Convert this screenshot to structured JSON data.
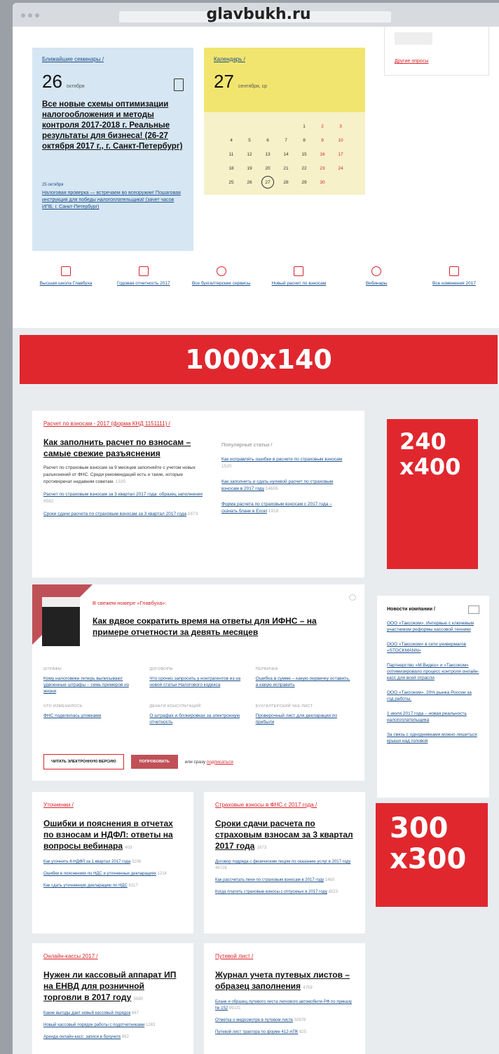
{
  "browser": {
    "domain": "glavbukh.ru"
  },
  "seminars": {
    "label": "Ближайшие семинары /",
    "day": "26",
    "month": "октября",
    "title": "Все новые схемы оптимизации налогообложения и методы контроля 2017-2018 г. Реальные результаты для бизнеса! (26-27 октября 2017 г., г. Санкт-Петербург)",
    "sub_date": "25 октября",
    "sub_text": "Налоговая проверка — встречаем во всеоружии! Пошаговая инструкция для победы налогоплательщика! (зачет часов ИПБ, г. Санкт-Петербург)"
  },
  "calendar": {
    "label": "Календарь /",
    "day": "27",
    "month": "сентября, ср",
    "rows": [
      [
        "",
        "",
        "",
        "",
        "1",
        "2",
        "3"
      ],
      [
        "4",
        "5",
        "6",
        "7",
        "8",
        "9",
        "10"
      ],
      [
        "11",
        "12",
        "13",
        "14",
        "15",
        "16",
        "17"
      ],
      [
        "18",
        "19",
        "20",
        "21",
        "22",
        "23",
        "24"
      ],
      [
        "25",
        "26",
        "27",
        "28",
        "29",
        "30",
        ""
      ]
    ]
  },
  "poll": {
    "other_link": "Другие опросы"
  },
  "quick_links": [
    {
      "label": "Высшая школа Главбуха",
      "icon": "book-icon"
    },
    {
      "label": "Годовая отчетность 2017",
      "icon": "document-icon"
    },
    {
      "label": "Все бухгалтерские сервисы",
      "icon": "chat-icon"
    },
    {
      "label": "Новый расчет по взносам",
      "icon": "calculator-icon"
    },
    {
      "label": "Вебинары",
      "icon": "play-icon"
    },
    {
      "label": "Все изменения 2017",
      "icon": "calendar-icon"
    }
  ],
  "banner_top": "1000x140",
  "card1": {
    "label": "Расчет по взносам - 2017 (форма КНД 1151111) /",
    "headline": "Как заполнить расчет по взносам – самые свежие разъяснения",
    "lead": "Расчет по страховым взносам за 9 месяцев заполняйте с учетом новых разъяснений от ФНС. Среди рекомендаций есть и такие, которые противоречат недавним советам.",
    "lead_views": "1335",
    "links": [
      {
        "text": "Расчет по страховым взносам за 3 квартал 2017 года: образец заполнения",
        "views": "9582"
      },
      {
        "text": "Сроки сдачи расчета по страховым взносам за 3 квартал 2017 года",
        "views": "1673"
      }
    ],
    "popular_title": "Популярные статьи /",
    "popular": [
      {
        "text": "Как исправлять ошибки в расчете по страховым взносам",
        "views": "1520"
      },
      {
        "text": "Как заполнить и сдать нулевой расчет по страховым взносам в 2017 году",
        "views": "14606"
      },
      {
        "text": "Форма расчета по страховым взносам с 2017 года – скачать бланк в Excel",
        "views": "1918"
      }
    ]
  },
  "ad_240": "240 x400",
  "card2": {
    "label": "В свежем номере «Главбуха»:",
    "headline": "Как вдвое сократить время на ответы для ИФНС – на примере отчетности за девять месяцев",
    "items": [
      {
        "head": "ШТРАФЫ",
        "text": "Кому налоговики теперь выписывают удвоенные штрафы – семь примеров из жизни"
      },
      {
        "head": "ДОГОВОРЫ",
        "text": "Что срочно запросить у контрагентов из-за новой статьи Налогового кодекса"
      },
      {
        "head": "ПЕРВИЧКА",
        "text": "Ошибка в сумме – какую первичку оставить, а какую исправить"
      },
      {
        "head": "ЧТО ИЗМЕНИЛОСЬ",
        "text": "ФНС поделилась уловками"
      },
      {
        "head": "ДЕНЬГИ КОНСУЛЬТАЦИЙ",
        "text": "О штрафах и блокировках за электронную отчетность"
      },
      {
        "head": "БУХГАЛТЕРСКИЙ ЧЕК-ЛИСТ",
        "text": "Проверочный лист для декларации по прибыли"
      }
    ],
    "btn_read": "ЧИТАТЬ ЭЛЕКТРОННУЮ ВЕРСИЮ",
    "btn_try": "ПОПРОБОВАТЬ",
    "or_text": "или сразу",
    "subscribe": "подписаться"
  },
  "news": {
    "title": "Новости компании /",
    "items": [
      "ООО «Таксоком». Интервью с ключевым участником реформы кассовой техники",
      "ООО «Таксоком» в сети универмагов «STOCKMANN»",
      "Партнерство «М.Видео» и «Таксоком» оптимизировало процесс контроля онлайн-касс для всей отрасли",
      "ООО «Таксоком». 20% рынка России за год работы.",
      "1 июля 2017 года – новая реальность налогоплательщика",
      "За связь с однодневками можно лишиться крыши над головой"
    ]
  },
  "ad_300": "300 x300",
  "card3": {
    "label": "Уточненки /",
    "headline": "Ошибки и пояснения в отчетах по взносам и НДФЛ: ответы на вопросы вебинара",
    "headline_views": "403",
    "links": [
      {
        "text": "Как уточнить 6-НДФЛ за 1 квартал 2017 года",
        "views": "3106"
      },
      {
        "text": "Ошибки в пояснениях по НДС и уточненных декларациях",
        "views": "1214"
      },
      {
        "text": "Как сдать уточненную декларацию по НДС",
        "views": "6317"
      }
    ]
  },
  "card4": {
    "label": "Страховые взносы в ФНС с 2017 года /",
    "headline": "Сроки сдачи расчета по страховым взносам за 3 квартал 2017 года",
    "headline_views": "1673",
    "links": [
      {
        "text": "Договор подряда с физическим лицом по оказанию услуг в 2017 году",
        "views": "46728"
      },
      {
        "text": "Как рассчитать пени по страховым взносам в 2017 году",
        "views": "1460"
      },
      {
        "text": "Когда платить страховые взносы с отпускных в 2017 году",
        "views": "4523"
      }
    ]
  },
  "card5": {
    "label": "Онлайн-кассы 2017 /",
    "headline": "Нужен ли кассовый аппарат ИП на ЕНВД для розничной торговли в 2017 году",
    "headline_views": "5580",
    "links": [
      {
        "text": "Какие выгоды дает новый кассовый порядок",
        "views": "667"
      },
      {
        "text": "Новый кассовый порядок работы с подотчетниками",
        "views": "1283"
      },
      {
        "text": "Аренда онлайн-касс: записи в бухучете",
        "views": "992"
      }
    ]
  },
  "card6": {
    "label": "Путевой лист /",
    "headline": "Журнал учета путевых листов – образец заполнения",
    "headline_views": "4759",
    "links": [
      {
        "text": "Бланк и образец путевого листа легкового автомобиля РФ по приказу № 152",
        "views": "99131"
      },
      {
        "text": "Отметка о медосмотре в путевом листе",
        "views": "32878"
      },
      {
        "text": "Путевой лист трактора по форме 412-АПК",
        "views": "925"
      }
    ]
  }
}
